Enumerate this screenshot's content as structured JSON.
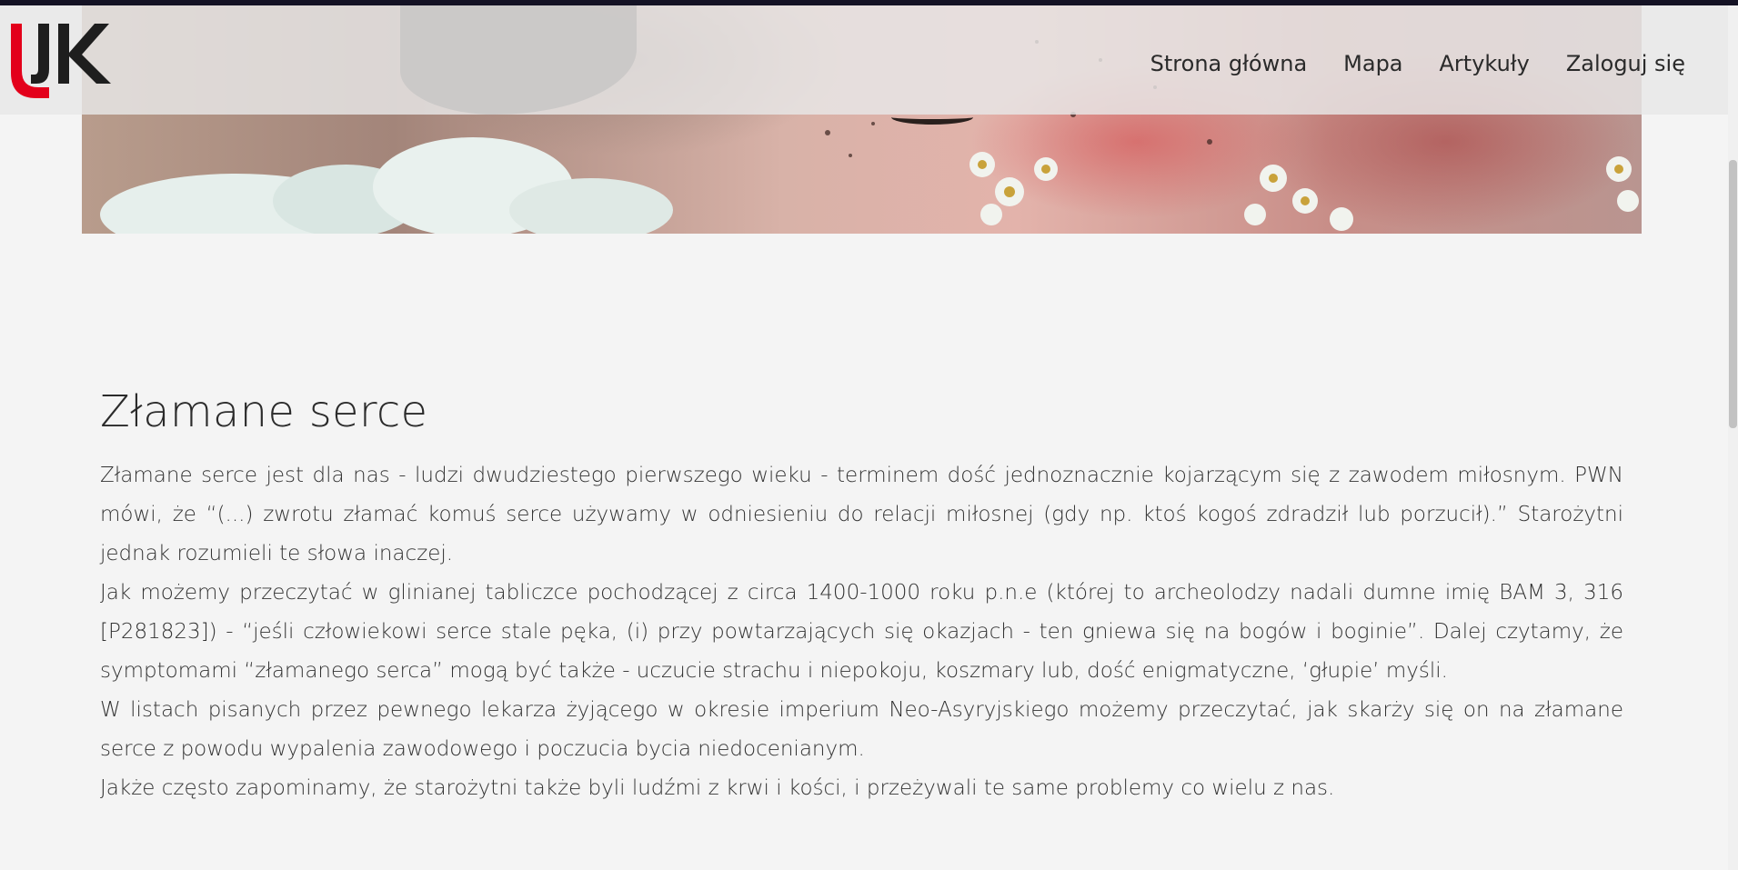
{
  "colors": {
    "top_strip": "#141224",
    "logo_red": "#e3001b",
    "logo_black": "#1e1e1e",
    "background": "#f4f4f4"
  },
  "header": {
    "logo_text": "UJK",
    "nav": [
      {
        "label": "Strona główna"
      },
      {
        "label": "Mapa"
      },
      {
        "label": "Artykuły"
      },
      {
        "label": "Zaloguj się"
      }
    ]
  },
  "article": {
    "title": "Złamane serce",
    "paragraphs": [
      "Złamane serce jest dla nas - ludzi dwudziestego pierwszego wieku - terminem dość jednoznacznie kojarzącym się z zawodem miłosnym. PWN mówi, że “(...) zwrotu złamać komuś serce używamy w odniesieniu do relacji miłosnej (gdy np. ktoś kogoś zdradził lub porzucił).” Starożytni jednak rozumieli te słowa inaczej.",
      "Jak możemy przeczytać w glinianej tabliczce pochodzącej z circa 1400-1000 roku p.n.e (której to archeolodzy nadali dumne imię BAM 3, 316 [P281823]) - “jeśli człowiekowi serce stale pęka, (i) przy powtarzających się okazjach - ten gniewa się na bogów i boginie”. Dalej czytamy, że symptomami “złamanego serca” mogą być także - uczucie strachu i niepokoju, koszmary lub, dość enigmatyczne, ‘głupie’ myśli.",
      "W listach pisanych przez pewnego lekarza żyjącego w okresie imperium Neo-Asyryjskiego możemy przeczytać, jak skarży się on na złamane serce z powodu wypalenia zawodowego i poczucia bycia niedocenianym.",
      "Jakże często zapominamy, że starożytni także byli ludźmi z krwi i kości, i przeżywali te same problemy co wielu z nas."
    ]
  }
}
